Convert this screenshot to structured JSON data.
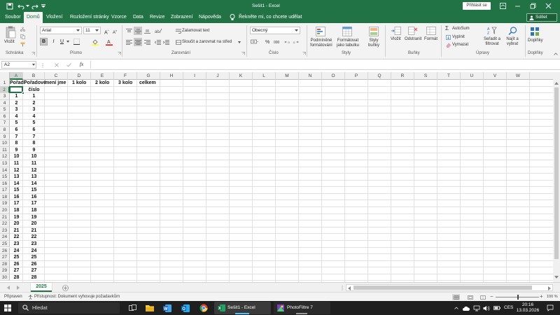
{
  "window": {
    "title": "Sešit1 - Excel",
    "sign_in": "Přihlásit se"
  },
  "tabs": [
    {
      "label": "Soubor"
    },
    {
      "label": "Domů"
    },
    {
      "label": "Vložení"
    },
    {
      "label": "Rozložení stránky"
    },
    {
      "label": "Vzorce"
    },
    {
      "label": "Data"
    },
    {
      "label": "Revize"
    },
    {
      "label": "Zobrazení"
    },
    {
      "label": "Nápověda"
    }
  ],
  "tell_me": "Řekněte mi, co chcete udělat",
  "share": "Sdílet",
  "ribbon": {
    "clipboard": {
      "paste": "Vložit",
      "label": "Schránka"
    },
    "font": {
      "name": "Arial",
      "size": "11",
      "bold": "B",
      "italic": "I",
      "underline": "U",
      "label": "Písmo"
    },
    "alignment": {
      "wrap": "Zalamovat text",
      "merge": "Sloučit a zarovnat na střed",
      "label": "Zarovnání"
    },
    "number": {
      "format": "Obecný",
      "percent": "%",
      "thousands": "000",
      "label": "Číslo"
    },
    "styles": {
      "conditional": "Podmíněné formátování",
      "conditional_1": "Podmíněné",
      "conditional_2": "formátování",
      "table_1": "Formátovat",
      "table_2": "jako tabulku",
      "cell_1": "Styly",
      "cell_2": "buňky",
      "label": "Styly"
    },
    "cells": {
      "insert": "Vložit",
      "delete": "Odstranit",
      "format": "Formát",
      "label": "Buňky"
    },
    "editing": {
      "autosum": "AutoSum",
      "fill": "Vyplnit",
      "clear": "Vymazat",
      "sort_1": "Seřadit a",
      "sort_2": "filtrovat",
      "find_1": "Najít a",
      "find_2": "vybrat",
      "label": "Úpravy"
    },
    "addins": {
      "label_btn": "Doplňky",
      "label": "Doplňky"
    }
  },
  "formula_bar": {
    "name_box": "A2",
    "fx": "fx",
    "value": ""
  },
  "columns": [
    "A",
    "B",
    "C",
    "D",
    "E",
    "F",
    "G",
    "H",
    "I",
    "J",
    "K",
    "L",
    "M",
    "N",
    "O",
    "P",
    "Q",
    "R",
    "S",
    "T",
    "U",
    "V",
    "W"
  ],
  "header_row": {
    "A": "Pořadí",
    "B": "Pořadové",
    "C": "mení jme",
    "D": "1 kolo",
    "E": "2 kolo",
    "F": "3 kolo",
    "G": "celkem"
  },
  "row2_B": "číslo",
  "row_numbers": [
    "1",
    "2",
    "3",
    "4",
    "5",
    "6",
    "7",
    "8",
    "9",
    "10",
    "11",
    "12",
    "13",
    "14",
    "15",
    "16",
    "17",
    "18",
    "19",
    "20",
    "21",
    "22",
    "23",
    "24",
    "25",
    "26",
    "27",
    "28",
    "29",
    "30"
  ],
  "col_a_values": [
    "",
    "",
    "1",
    "2",
    "3",
    "4",
    "5",
    "6",
    "7",
    "8",
    "9",
    "10",
    "11",
    "12",
    "13",
    "14",
    "15",
    "16",
    "17",
    "18",
    "19",
    "20",
    "21",
    "22",
    "23",
    "24",
    "25",
    "26",
    "27",
    "28"
  ],
  "col_b_values": [
    "",
    "",
    "1",
    "2",
    "3",
    "4",
    "5",
    "6",
    "7",
    "8",
    "9",
    "10",
    "11",
    "12",
    "13",
    "14",
    "15",
    "16",
    "17",
    "18",
    "19",
    "20",
    "21",
    "22",
    "23",
    "24",
    "25",
    "26",
    "27",
    "28"
  ],
  "sheet_tab": "2025",
  "status": {
    "ready": "Připraven",
    "accessibility": "Přístupnost: Dokument vyhovuje požadavkům",
    "zoom": "100 %"
  },
  "taskbar": {
    "search": "Hledat",
    "excel": "Sešit1 - Excel",
    "photofiltre": "PhotoFiltre 7",
    "lang": "CES",
    "time": "20:16",
    "date": "13.03.2026"
  },
  "colors": {
    "excel_green": "#217346",
    "selection": "#217346",
    "taskbar": "#1f1f1f"
  }
}
